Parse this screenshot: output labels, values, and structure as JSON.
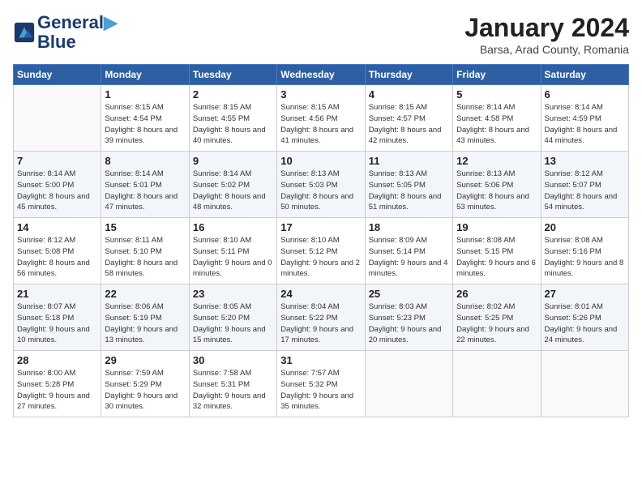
{
  "header": {
    "logo_line1": "General",
    "logo_line2": "Blue",
    "month_title": "January 2024",
    "location": "Barsa, Arad County, Romania"
  },
  "days_of_week": [
    "Sunday",
    "Monday",
    "Tuesday",
    "Wednesday",
    "Thursday",
    "Friday",
    "Saturday"
  ],
  "weeks": [
    [
      {
        "num": "",
        "sunrise": "",
        "sunset": "",
        "daylight": ""
      },
      {
        "num": "1",
        "sunrise": "Sunrise: 8:15 AM",
        "sunset": "Sunset: 4:54 PM",
        "daylight": "Daylight: 8 hours and 39 minutes."
      },
      {
        "num": "2",
        "sunrise": "Sunrise: 8:15 AM",
        "sunset": "Sunset: 4:55 PM",
        "daylight": "Daylight: 8 hours and 40 minutes."
      },
      {
        "num": "3",
        "sunrise": "Sunrise: 8:15 AM",
        "sunset": "Sunset: 4:56 PM",
        "daylight": "Daylight: 8 hours and 41 minutes."
      },
      {
        "num": "4",
        "sunrise": "Sunrise: 8:15 AM",
        "sunset": "Sunset: 4:57 PM",
        "daylight": "Daylight: 8 hours and 42 minutes."
      },
      {
        "num": "5",
        "sunrise": "Sunrise: 8:14 AM",
        "sunset": "Sunset: 4:58 PM",
        "daylight": "Daylight: 8 hours and 43 minutes."
      },
      {
        "num": "6",
        "sunrise": "Sunrise: 8:14 AM",
        "sunset": "Sunset: 4:59 PM",
        "daylight": "Daylight: 8 hours and 44 minutes."
      }
    ],
    [
      {
        "num": "7",
        "sunrise": "Sunrise: 8:14 AM",
        "sunset": "Sunset: 5:00 PM",
        "daylight": "Daylight: 8 hours and 45 minutes."
      },
      {
        "num": "8",
        "sunrise": "Sunrise: 8:14 AM",
        "sunset": "Sunset: 5:01 PM",
        "daylight": "Daylight: 8 hours and 47 minutes."
      },
      {
        "num": "9",
        "sunrise": "Sunrise: 8:14 AM",
        "sunset": "Sunset: 5:02 PM",
        "daylight": "Daylight: 8 hours and 48 minutes."
      },
      {
        "num": "10",
        "sunrise": "Sunrise: 8:13 AM",
        "sunset": "Sunset: 5:03 PM",
        "daylight": "Daylight: 8 hours and 50 minutes."
      },
      {
        "num": "11",
        "sunrise": "Sunrise: 8:13 AM",
        "sunset": "Sunset: 5:05 PM",
        "daylight": "Daylight: 8 hours and 51 minutes."
      },
      {
        "num": "12",
        "sunrise": "Sunrise: 8:13 AM",
        "sunset": "Sunset: 5:06 PM",
        "daylight": "Daylight: 8 hours and 53 minutes."
      },
      {
        "num": "13",
        "sunrise": "Sunrise: 8:12 AM",
        "sunset": "Sunset: 5:07 PM",
        "daylight": "Daylight: 8 hours and 54 minutes."
      }
    ],
    [
      {
        "num": "14",
        "sunrise": "Sunrise: 8:12 AM",
        "sunset": "Sunset: 5:08 PM",
        "daylight": "Daylight: 8 hours and 56 minutes."
      },
      {
        "num": "15",
        "sunrise": "Sunrise: 8:11 AM",
        "sunset": "Sunset: 5:10 PM",
        "daylight": "Daylight: 8 hours and 58 minutes."
      },
      {
        "num": "16",
        "sunrise": "Sunrise: 8:10 AM",
        "sunset": "Sunset: 5:11 PM",
        "daylight": "Daylight: 9 hours and 0 minutes."
      },
      {
        "num": "17",
        "sunrise": "Sunrise: 8:10 AM",
        "sunset": "Sunset: 5:12 PM",
        "daylight": "Daylight: 9 hours and 2 minutes."
      },
      {
        "num": "18",
        "sunrise": "Sunrise: 8:09 AM",
        "sunset": "Sunset: 5:14 PM",
        "daylight": "Daylight: 9 hours and 4 minutes."
      },
      {
        "num": "19",
        "sunrise": "Sunrise: 8:08 AM",
        "sunset": "Sunset: 5:15 PM",
        "daylight": "Daylight: 9 hours and 6 minutes."
      },
      {
        "num": "20",
        "sunrise": "Sunrise: 8:08 AM",
        "sunset": "Sunset: 5:16 PM",
        "daylight": "Daylight: 9 hours and 8 minutes."
      }
    ],
    [
      {
        "num": "21",
        "sunrise": "Sunrise: 8:07 AM",
        "sunset": "Sunset: 5:18 PM",
        "daylight": "Daylight: 9 hours and 10 minutes."
      },
      {
        "num": "22",
        "sunrise": "Sunrise: 8:06 AM",
        "sunset": "Sunset: 5:19 PM",
        "daylight": "Daylight: 9 hours and 13 minutes."
      },
      {
        "num": "23",
        "sunrise": "Sunrise: 8:05 AM",
        "sunset": "Sunset: 5:20 PM",
        "daylight": "Daylight: 9 hours and 15 minutes."
      },
      {
        "num": "24",
        "sunrise": "Sunrise: 8:04 AM",
        "sunset": "Sunset: 5:22 PM",
        "daylight": "Daylight: 9 hours and 17 minutes."
      },
      {
        "num": "25",
        "sunrise": "Sunrise: 8:03 AM",
        "sunset": "Sunset: 5:23 PM",
        "daylight": "Daylight: 9 hours and 20 minutes."
      },
      {
        "num": "26",
        "sunrise": "Sunrise: 8:02 AM",
        "sunset": "Sunset: 5:25 PM",
        "daylight": "Daylight: 9 hours and 22 minutes."
      },
      {
        "num": "27",
        "sunrise": "Sunrise: 8:01 AM",
        "sunset": "Sunset: 5:26 PM",
        "daylight": "Daylight: 9 hours and 24 minutes."
      }
    ],
    [
      {
        "num": "28",
        "sunrise": "Sunrise: 8:00 AM",
        "sunset": "Sunset: 5:28 PM",
        "daylight": "Daylight: 9 hours and 27 minutes."
      },
      {
        "num": "29",
        "sunrise": "Sunrise: 7:59 AM",
        "sunset": "Sunset: 5:29 PM",
        "daylight": "Daylight: 9 hours and 30 minutes."
      },
      {
        "num": "30",
        "sunrise": "Sunrise: 7:58 AM",
        "sunset": "Sunset: 5:31 PM",
        "daylight": "Daylight: 9 hours and 32 minutes."
      },
      {
        "num": "31",
        "sunrise": "Sunrise: 7:57 AM",
        "sunset": "Sunset: 5:32 PM",
        "daylight": "Daylight: 9 hours and 35 minutes."
      },
      {
        "num": "",
        "sunrise": "",
        "sunset": "",
        "daylight": ""
      },
      {
        "num": "",
        "sunrise": "",
        "sunset": "",
        "daylight": ""
      },
      {
        "num": "",
        "sunrise": "",
        "sunset": "",
        "daylight": ""
      }
    ]
  ]
}
